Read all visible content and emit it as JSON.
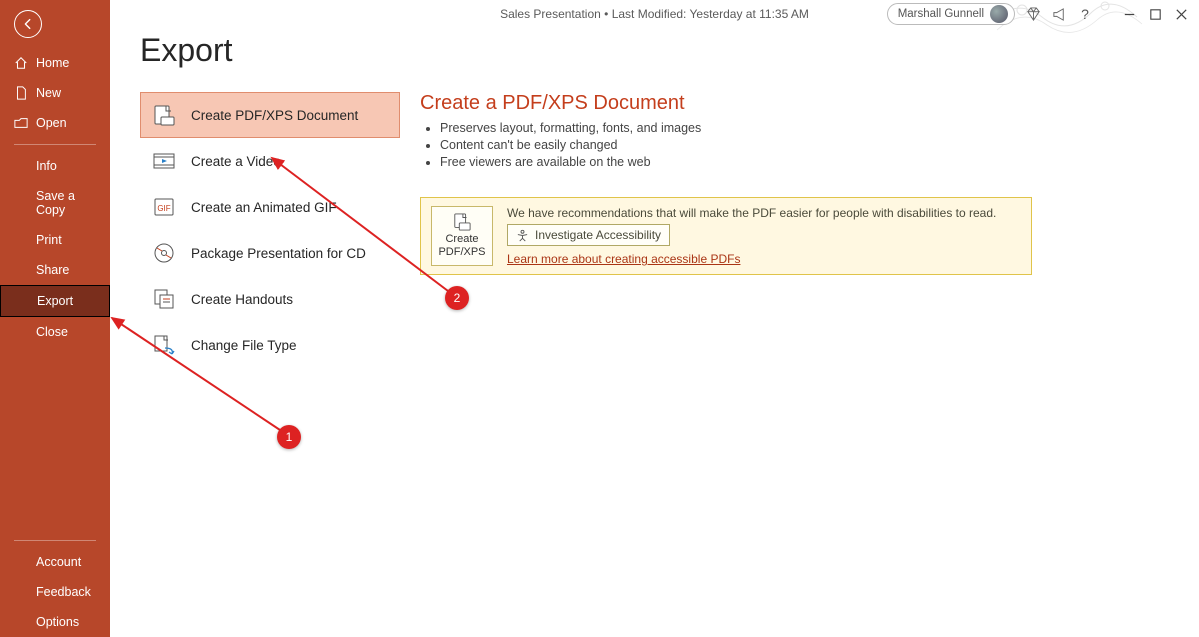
{
  "titlebar": {
    "doc_title": "Sales Presentation",
    "last_modified": "Last Modified: Yesterday at 11:35 AM",
    "user_name": "Marshall Gunnell"
  },
  "sidebar": {
    "home": "Home",
    "new": "New",
    "open": "Open",
    "info": "Info",
    "save_copy": "Save a Copy",
    "print": "Print",
    "share": "Share",
    "export": "Export",
    "close": "Close",
    "account": "Account",
    "feedback": "Feedback",
    "options": "Options"
  },
  "page": {
    "title": "Export"
  },
  "export_options": {
    "pdf": "Create PDF/XPS Document",
    "video": "Create a Video",
    "gif": "Create an Animated GIF",
    "cd": "Package Presentation for CD",
    "handouts": "Create Handouts",
    "filetype": "Change File Type"
  },
  "detail": {
    "heading": "Create a PDF/XPS Document",
    "bullets": [
      "Preserves layout, formatting, fonts, and images",
      "Content can't be easily changed",
      "Free viewers are available on the web"
    ],
    "info_text": "We have recommendations that will make the PDF easier for people with disabilities to read.",
    "investigate": "Investigate Accessibility",
    "link": "Learn more about creating accessible PDFs",
    "create_line1": "Create",
    "create_line2": "PDF/XPS"
  },
  "annotations": {
    "badge1": "1",
    "badge2": "2"
  }
}
